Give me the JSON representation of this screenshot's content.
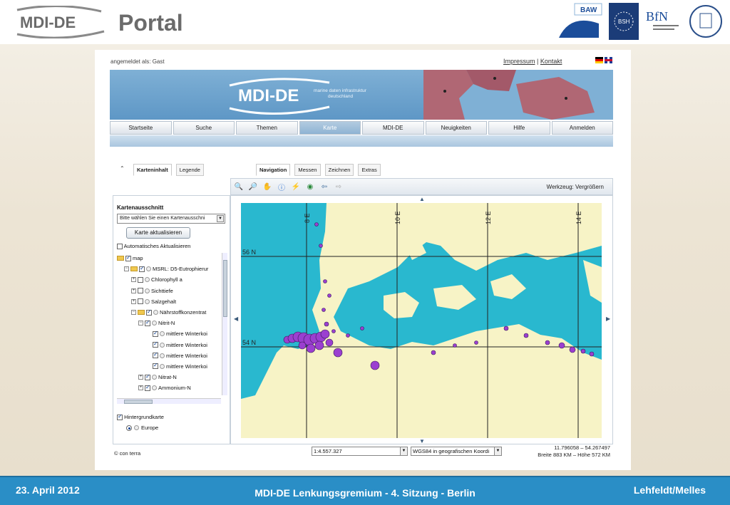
{
  "slide": {
    "logo_text": "MDI-DE",
    "title": "Portal",
    "partner_logos": [
      "BAW",
      "BSH",
      "BfN"
    ],
    "footer_left": "23. April 2012",
    "footer_center": "MDI-DE Lenkungsgremium - 4. Sitzung - Berlin",
    "footer_right": "Lehfeldt/Melles"
  },
  "web": {
    "login_status": "angemeldet als: Gast",
    "links": [
      "Impressum",
      "Kontakt"
    ],
    "banner_logo": "MDI-DE",
    "banner_tagline": [
      "marine daten infrastruktur",
      "deutschland"
    ],
    "nav_tabs": [
      "Startseite",
      "Suche",
      "Themen",
      "Karte",
      "MDI-DE",
      "Neuigkeiten",
      "Hilfe",
      "Anmelden"
    ],
    "active_nav": "Karte",
    "panel_tabs": [
      "Karteninhalt",
      "Legende"
    ],
    "tool_tabs": [
      "Navigation",
      "Messen",
      "Zeichnen",
      "Extras"
    ],
    "tool_status": "Werkzeug: Vergrößern",
    "section_label": "Kartenausschnitt",
    "select_placeholder": "Bitte wählen Sie einen Kartenausschni",
    "refresh_button": "Karte aktualisieren",
    "auto_refresh": "Automatisches Aktualisieren",
    "tree": [
      {
        "label": "map",
        "level": 0
      },
      {
        "label": "MSRL: D5-Eutrophierur",
        "level": 1
      },
      {
        "label": "Chlorophyll a",
        "level": 2
      },
      {
        "label": "Sichttiefe",
        "level": 2
      },
      {
        "label": "Salzgehalt",
        "level": 2
      },
      {
        "label": "Nährstoffkonzentrat",
        "level": 2
      },
      {
        "label": "Nitrit-N",
        "level": 3
      },
      {
        "label": "mittlere Winterkoi",
        "level": 4
      },
      {
        "label": "mittlere Winterkoi",
        "level": 4
      },
      {
        "label": "mittlere Winterkoi",
        "level": 4
      },
      {
        "label": "mittlere Winterkoi",
        "level": 4
      },
      {
        "label": "Nitrat-N",
        "level": 3
      },
      {
        "label": "Ammonium-N",
        "level": 3
      }
    ],
    "background_map": "Hintergrundkarte",
    "europe": "Europe",
    "map_labels": {
      "lat56": "56 N",
      "lat54": "54 N",
      "lon8": "8 E",
      "lon10": "10 E",
      "lon12": "12 E",
      "lon14": "14 E"
    },
    "copyright": "© con terra",
    "scale": "1:4.557.327",
    "crs": "WGS84 in geografischen Koordi",
    "coords": "11.796058 – 54.267497",
    "extent": "Breite 883 KM – Höhe 572 KM"
  },
  "colors": {
    "sea": "#29b8cf",
    "land": "#f7f3c6",
    "points": "#9b3fd0",
    "footer": "#2a8ec6"
  }
}
